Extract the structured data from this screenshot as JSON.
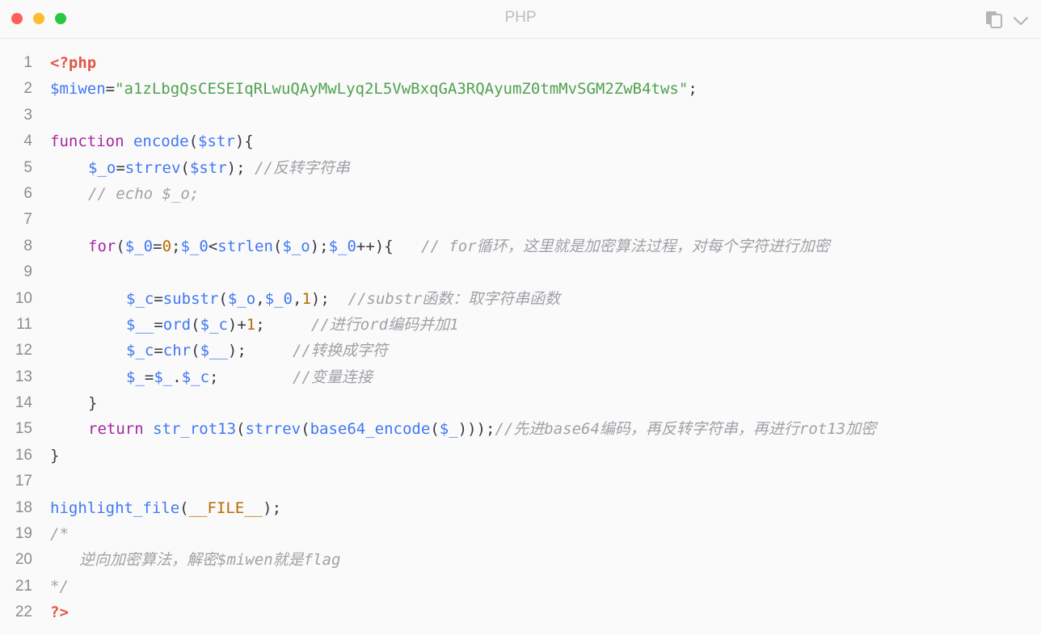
{
  "window": {
    "title": "PHP"
  },
  "code": {
    "lines": [
      {
        "n": "1",
        "indent": 0,
        "tokens": [
          {
            "t": "tag",
            "v": "<?php"
          }
        ]
      },
      {
        "n": "2",
        "indent": 0,
        "tokens": [
          {
            "t": "var",
            "v": "$miwen"
          },
          {
            "t": "op",
            "v": "="
          },
          {
            "t": "str",
            "v": "\"a1zLbgQsCESEIqRLwuQAyMwLyq2L5VwBxqGA3RQAyumZ0tmMvSGM2ZwB4tws\""
          },
          {
            "t": "p",
            "v": ";"
          }
        ]
      },
      {
        "n": "3",
        "indent": 0,
        "tokens": []
      },
      {
        "n": "4",
        "indent": 0,
        "tokens": [
          {
            "t": "kw",
            "v": "function "
          },
          {
            "t": "fn",
            "v": "encode"
          },
          {
            "t": "p",
            "v": "("
          },
          {
            "t": "var",
            "v": "$str"
          },
          {
            "t": "p",
            "v": "){"
          }
        ]
      },
      {
        "n": "5",
        "indent": 1,
        "tokens": [
          {
            "t": "var",
            "v": "$_o"
          },
          {
            "t": "op",
            "v": "="
          },
          {
            "t": "fn",
            "v": "strrev"
          },
          {
            "t": "p",
            "v": "("
          },
          {
            "t": "var",
            "v": "$str"
          },
          {
            "t": "p",
            "v": "); "
          },
          {
            "t": "com",
            "v": "//反转字符串"
          }
        ]
      },
      {
        "n": "6",
        "indent": 1,
        "tokens": [
          {
            "t": "com",
            "v": "// echo $_o;"
          }
        ]
      },
      {
        "n": "7",
        "indent": 0,
        "tokens": []
      },
      {
        "n": "8",
        "indent": 1,
        "tokens": [
          {
            "t": "kw",
            "v": "for"
          },
          {
            "t": "p",
            "v": "("
          },
          {
            "t": "var",
            "v": "$_0"
          },
          {
            "t": "op",
            "v": "="
          },
          {
            "t": "num",
            "v": "0"
          },
          {
            "t": "p",
            "v": ";"
          },
          {
            "t": "var",
            "v": "$_0"
          },
          {
            "t": "op",
            "v": "<"
          },
          {
            "t": "fn",
            "v": "strlen"
          },
          {
            "t": "p",
            "v": "("
          },
          {
            "t": "var",
            "v": "$_o"
          },
          {
            "t": "p",
            "v": ");"
          },
          {
            "t": "var",
            "v": "$_0"
          },
          {
            "t": "op",
            "v": "++"
          },
          {
            "t": "p",
            "v": "){   "
          },
          {
            "t": "com",
            "v": "// for循环，这里就是加密算法过程，对每个字符进行加密"
          }
        ]
      },
      {
        "n": "9",
        "indent": 0,
        "tokens": []
      },
      {
        "n": "10",
        "indent": 2,
        "tokens": [
          {
            "t": "var",
            "v": "$_c"
          },
          {
            "t": "op",
            "v": "="
          },
          {
            "t": "fn",
            "v": "substr"
          },
          {
            "t": "p",
            "v": "("
          },
          {
            "t": "var",
            "v": "$_o"
          },
          {
            "t": "p",
            "v": ","
          },
          {
            "t": "var",
            "v": "$_0"
          },
          {
            "t": "p",
            "v": ","
          },
          {
            "t": "num",
            "v": "1"
          },
          {
            "t": "p",
            "v": ");  "
          },
          {
            "t": "com",
            "v": "//substr函数：取字符串函数"
          }
        ]
      },
      {
        "n": "11",
        "indent": 2,
        "tokens": [
          {
            "t": "var",
            "v": "$__"
          },
          {
            "t": "op",
            "v": "="
          },
          {
            "t": "fn",
            "v": "ord"
          },
          {
            "t": "p",
            "v": "("
          },
          {
            "t": "var",
            "v": "$_c"
          },
          {
            "t": "p",
            "v": ")"
          },
          {
            "t": "op",
            "v": "+"
          },
          {
            "t": "num",
            "v": "1"
          },
          {
            "t": "p",
            "v": ";     "
          },
          {
            "t": "com",
            "v": "//进行ord编码并加1"
          }
        ]
      },
      {
        "n": "12",
        "indent": 2,
        "tokens": [
          {
            "t": "var",
            "v": "$_c"
          },
          {
            "t": "op",
            "v": "="
          },
          {
            "t": "fn",
            "v": "chr"
          },
          {
            "t": "p",
            "v": "("
          },
          {
            "t": "var",
            "v": "$__"
          },
          {
            "t": "p",
            "v": ");     "
          },
          {
            "t": "com",
            "v": "//转换成字符"
          }
        ]
      },
      {
        "n": "13",
        "indent": 2,
        "tokens": [
          {
            "t": "var",
            "v": "$_"
          },
          {
            "t": "op",
            "v": "="
          },
          {
            "t": "var",
            "v": "$_"
          },
          {
            "t": "op",
            "v": "."
          },
          {
            "t": "var",
            "v": "$_c"
          },
          {
            "t": "p",
            "v": ";        "
          },
          {
            "t": "com",
            "v": "//变量连接"
          }
        ]
      },
      {
        "n": "14",
        "indent": 1,
        "tokens": [
          {
            "t": "p",
            "v": "}"
          }
        ]
      },
      {
        "n": "15",
        "indent": 1,
        "tokens": [
          {
            "t": "kw",
            "v": "return "
          },
          {
            "t": "fn",
            "v": "str_rot13"
          },
          {
            "t": "p",
            "v": "("
          },
          {
            "t": "fn",
            "v": "strrev"
          },
          {
            "t": "p",
            "v": "("
          },
          {
            "t": "fn",
            "v": "base64_encode"
          },
          {
            "t": "p",
            "v": "("
          },
          {
            "t": "var",
            "v": "$_"
          },
          {
            "t": "p",
            "v": ")));"
          },
          {
            "t": "com",
            "v": "//先进base64编码，再反转字符串，再进行rot13加密"
          }
        ]
      },
      {
        "n": "16",
        "indent": 0,
        "tokens": [
          {
            "t": "p",
            "v": "}"
          }
        ]
      },
      {
        "n": "17",
        "indent": 0,
        "tokens": []
      },
      {
        "n": "18",
        "indent": 0,
        "tokens": [
          {
            "t": "fn",
            "v": "highlight_file"
          },
          {
            "t": "p",
            "v": "("
          },
          {
            "t": "const",
            "v": "__FILE__"
          },
          {
            "t": "p",
            "v": ");"
          }
        ]
      },
      {
        "n": "19",
        "indent": 0,
        "tokens": [
          {
            "t": "com",
            "v": "/*"
          }
        ]
      },
      {
        "n": "20",
        "indent": 3,
        "tokens": [
          {
            "t": "com",
            "v": "逆向加密算法，解密$miwen就是flag"
          }
        ]
      },
      {
        "n": "21",
        "indent": 0,
        "tokens": [
          {
            "t": "com",
            "v": "*/"
          }
        ]
      },
      {
        "n": "22",
        "indent": 0,
        "tokens": [
          {
            "t": "tag",
            "v": "?>"
          }
        ]
      }
    ]
  },
  "theme": {
    "background": "#fafafa",
    "close_color": "#fe5f57",
    "minimize_color": "#febc2e",
    "maximize_color": "#28c840"
  },
  "icons": {
    "copy": "copy-icon",
    "menu": "chevron-down-icon"
  }
}
